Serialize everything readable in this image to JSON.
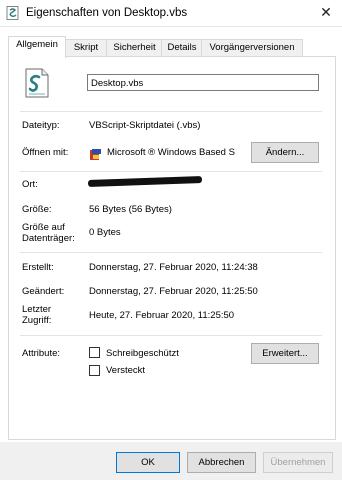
{
  "window": {
    "title": "Eigenschaften von Desktop.vbs",
    "close_symbol": "✕"
  },
  "tabs": [
    {
      "label": "Allgemein"
    },
    {
      "label": "Skript"
    },
    {
      "label": "Sicherheit"
    },
    {
      "label": "Details"
    },
    {
      "label": "Vorgängerversionen"
    }
  ],
  "general": {
    "filename": "Desktop.vbs",
    "filetype_label": "Dateityp:",
    "filetype_value": "VBScript-Skriptdatei (.vbs)",
    "opens_with_label": "Öffnen mit:",
    "opens_with_value": "Microsoft ® Windows Based S",
    "change_button": "Ändern...",
    "location_label": "Ort:",
    "size_label": "Größe:",
    "size_value": "56 Bytes (56 Bytes)",
    "size_on_disk_label": "Größe auf Datenträger:",
    "size_on_disk_value": "0 Bytes",
    "created_label": "Erstellt:",
    "created_value": "Donnerstag, 27. Februar 2020, 11:24:38",
    "modified_label": "Geändert:",
    "modified_value": "Donnerstag, 27. Februar 2020, 11:25:50",
    "accessed_label": "Letzter Zugriff:",
    "accessed_value": "Heute, 27. Februar 2020, 11:25:50",
    "attributes_label": "Attribute:",
    "readonly_label": "Schreibgeschützt",
    "hidden_label": "Versteckt",
    "advanced_button": "Erweitert..."
  },
  "footer": {
    "ok": "OK",
    "cancel": "Abbrechen",
    "apply": "Übernehmen"
  }
}
